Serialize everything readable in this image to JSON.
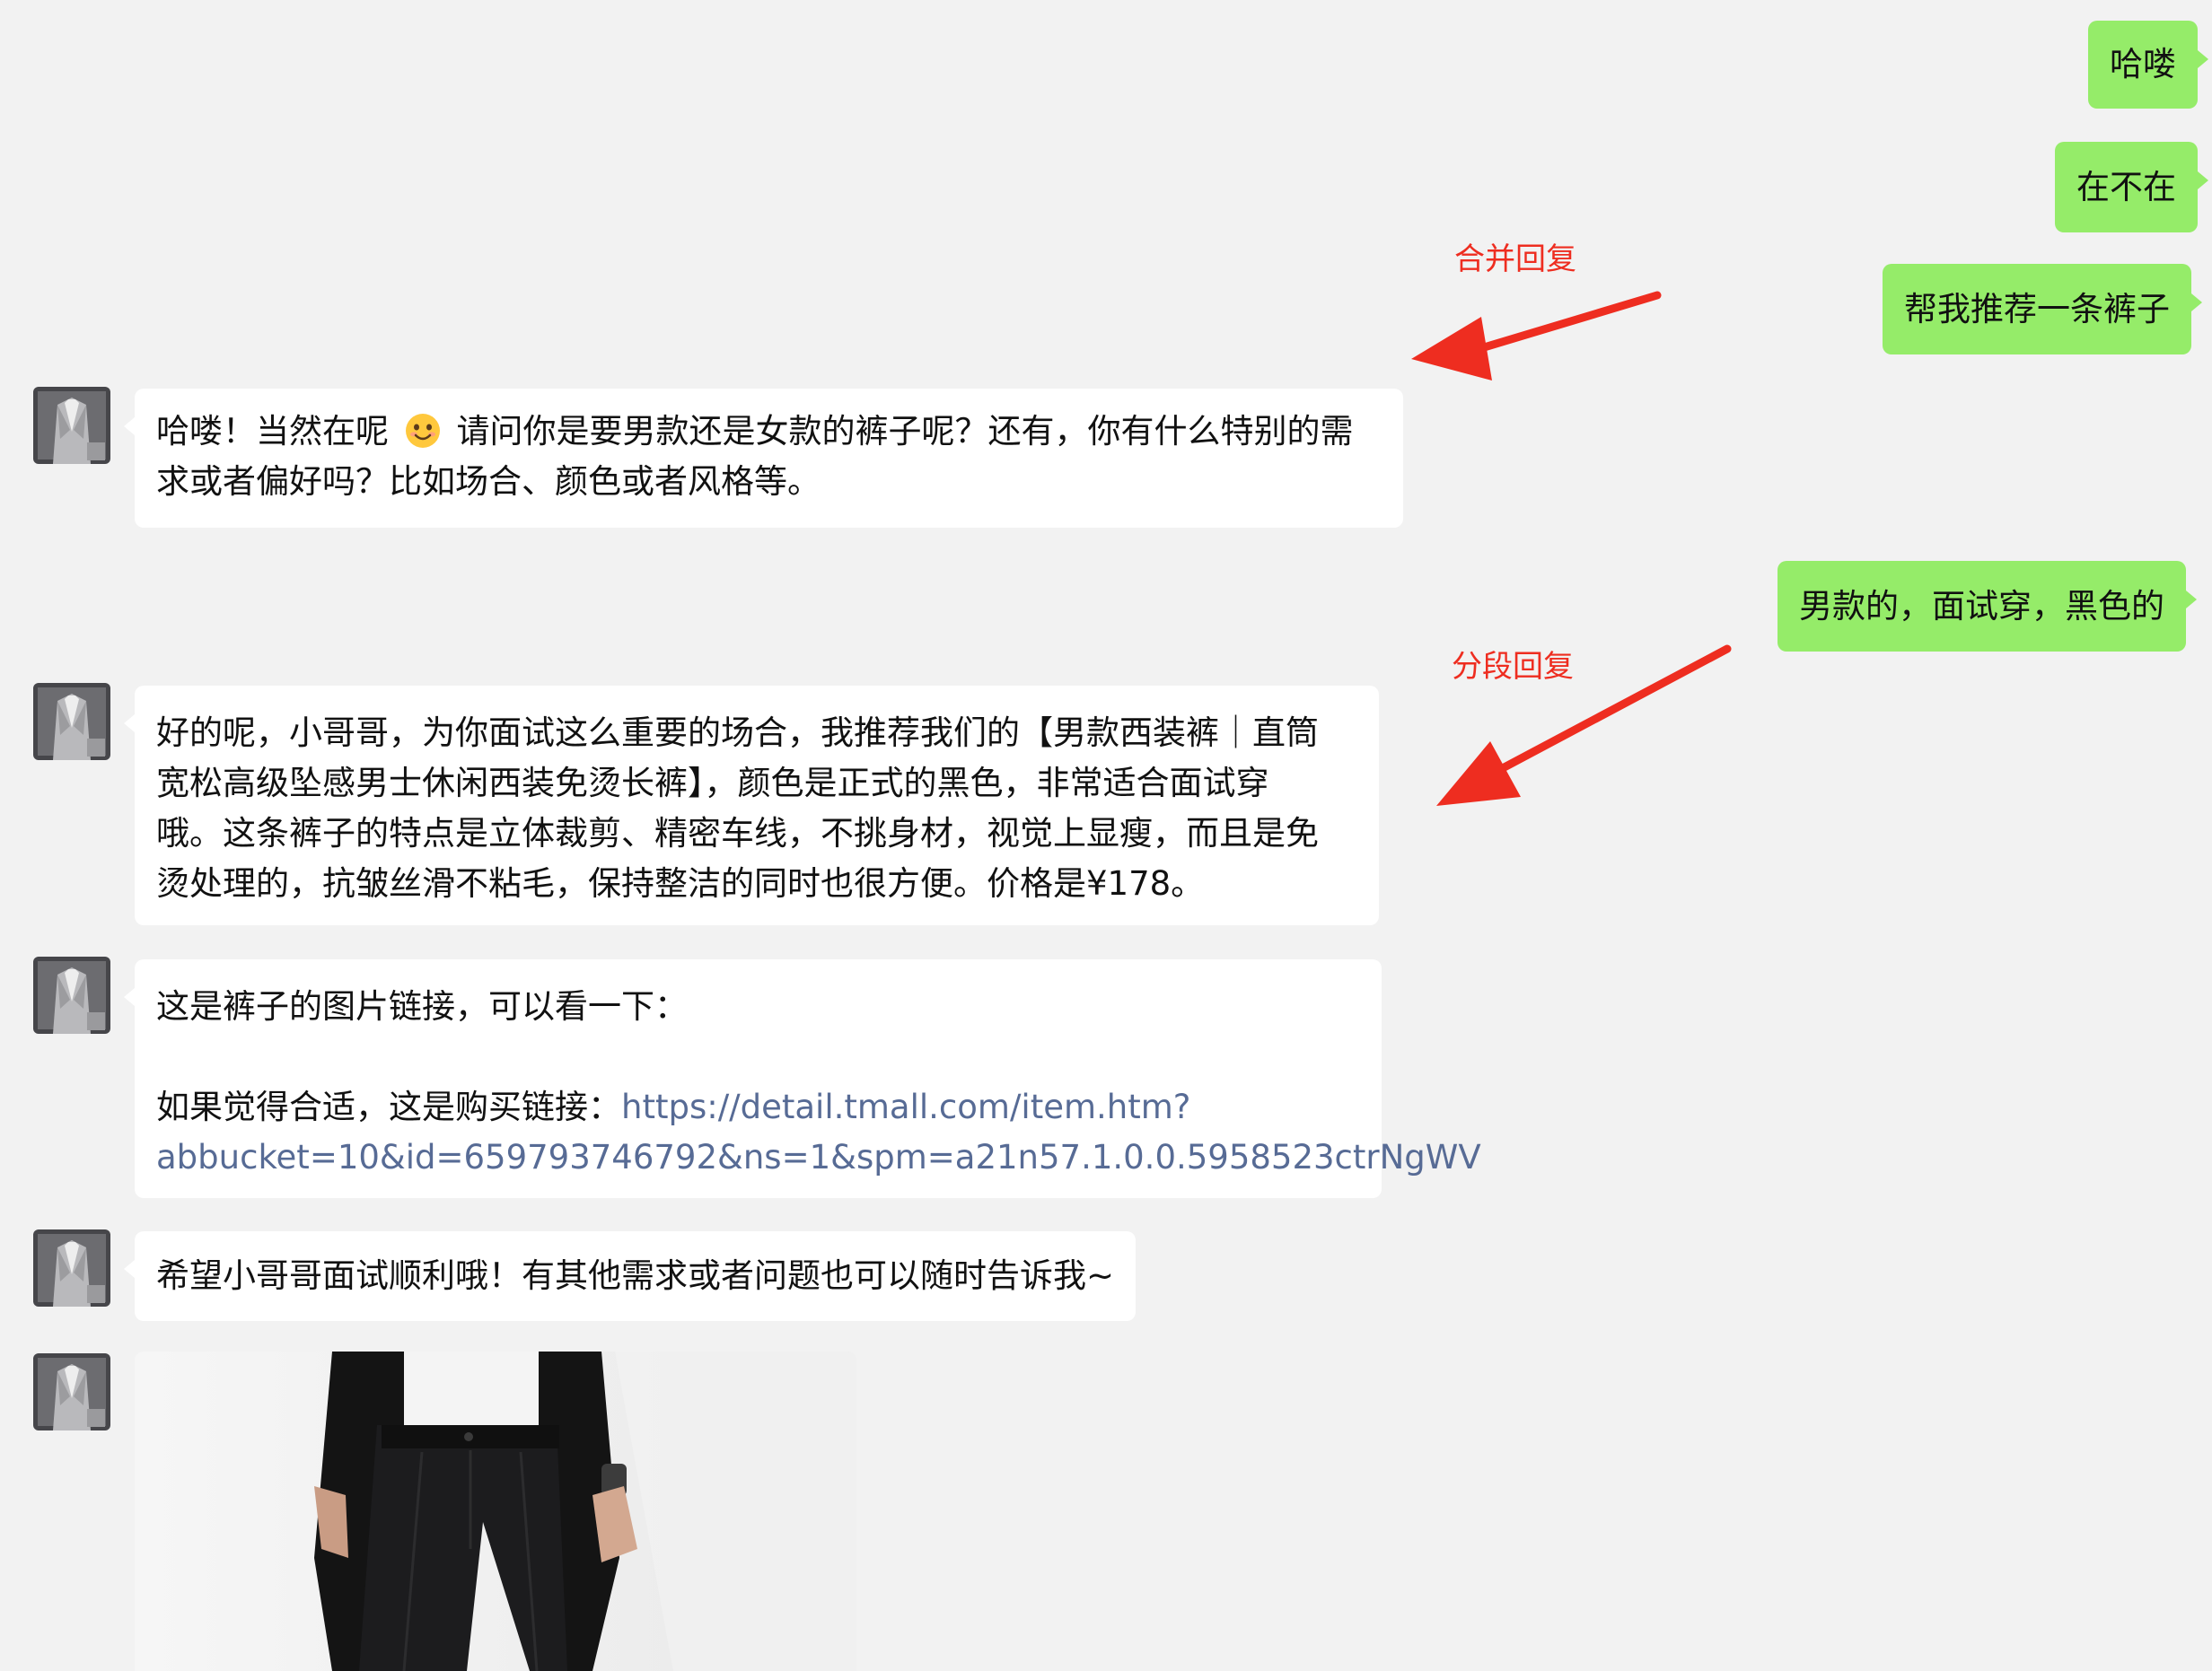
{
  "colors": {
    "background": "#f2f2f2",
    "sent_bubble": "#95ec69",
    "received_bubble": "#ffffff",
    "link": "#576b95",
    "annotation": "#ee2d20"
  },
  "annotations": {
    "merge": "合并回复",
    "segment": "分段回复"
  },
  "messages": {
    "m1": "哈喽",
    "m2": "在不在",
    "m3": "帮我推荐一条裤子",
    "r1": {
      "line1_part1": "哈喽！当然在呢",
      "emoji": "smiling-face-emoji",
      "line1_part2": " 请问你是要男款还是女款的裤子呢？还有，你有什么特别的需",
      "line2": "求或者偏好吗？比如场合、颜色或者风格等。"
    },
    "m4": "男款的，面试穿，黑色的",
    "r2": {
      "lines": [
        "好的呢，小哥哥，为你面试这么重要的场合，我推荐我们的【男款西装裤｜直筒",
        "宽松高级坠感男士休闲西装免烫长裤】，颜色是正式的黑色，非常适合面试穿",
        "哦。这条裤子的特点是立体裁剪、精密车线，不挑身材，视觉上显瘦，而且是免",
        "烫处理的，抗皱丝滑不粘毛，保持整洁的同时也很方便。价格是¥178。"
      ]
    },
    "r3": {
      "line1": "这是裤子的图片链接，可以看一下：",
      "line2_prefix": "如果觉得合适，这是购买链接：",
      "link_part1": "https://detail.tmall.com/item.htm?",
      "link_part2": "abbucket=10&id=659793746792&ns=1&spm=a21n57.1.0.0.5958523ctrNgWV"
    },
    "r4": "希望小哥哥面试顺利哦！有其他需求或者问题也可以随时告诉我~"
  }
}
